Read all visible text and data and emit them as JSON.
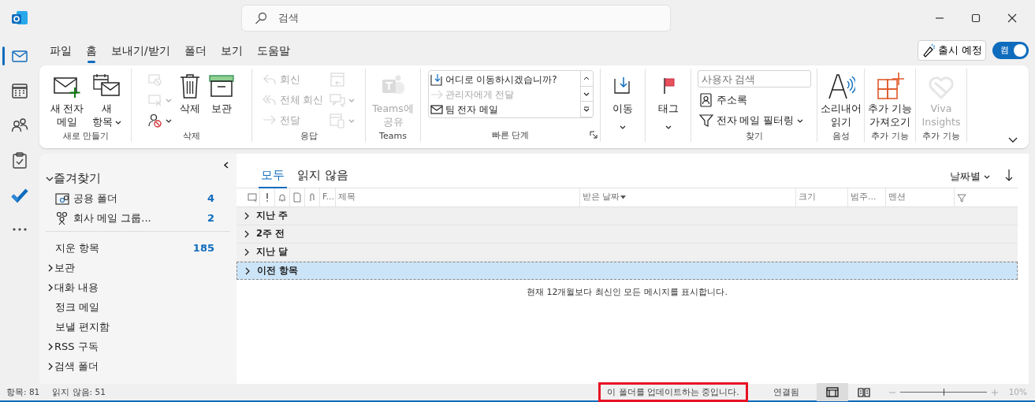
{
  "window": {
    "search_placeholder": "검색"
  },
  "rail": [
    {
      "selected": true
    },
    {
      "selected": false
    },
    {
      "selected": false
    },
    {
      "selected": false
    },
    {
      "selected": false
    },
    {
      "selected": false
    }
  ],
  "menu_tabs": [
    {
      "label": "파일",
      "selected": false
    },
    {
      "label": "홈",
      "selected": true
    },
    {
      "label": "보내기/받기",
      "selected": false
    },
    {
      "label": "폴더",
      "selected": false
    },
    {
      "label": "보기",
      "selected": false
    },
    {
      "label": "도움말",
      "selected": false
    }
  ],
  "coming_soon": {
    "label": "출시 예정",
    "toggle_label": "켬",
    "on": true
  },
  "ribbon": {
    "groups": [
      {
        "label": "새로 만들기",
        "items": [
          {
            "kind": "large",
            "lines": [
              "새 전자",
              "메일"
            ],
            "disabled": false,
            "dropdown": false
          },
          {
            "kind": "large",
            "lines": [
              "새",
              "항목"
            ],
            "disabled": false,
            "dropdown": true
          }
        ]
      },
      {
        "label": "삭제",
        "items": [
          {
            "kind": "stack",
            "entries": [
              {
                "disabled": true,
                "dropdown": false
              },
              {
                "disabled": true,
                "dropdown": true
              },
              {
                "disabled": false,
                "dropdown": true
              }
            ]
          },
          {
            "kind": "large",
            "lines": [
              "삭제"
            ],
            "disabled": false,
            "dropdown": false
          },
          {
            "kind": "large",
            "lines": [
              "보관"
            ],
            "disabled": false,
            "dropdown": false
          }
        ]
      },
      {
        "label": "응답",
        "items": [
          {
            "kind": "stack",
            "entries": [
              {
                "label": "회신",
                "disabled": true,
                "dropdown": false
              },
              {
                "label": "전체 회신",
                "disabled": true,
                "dropdown": false
              },
              {
                "label": "전달",
                "disabled": true,
                "dropdown": false
              }
            ]
          },
          {
            "kind": "stack",
            "entries": [
              {
                "disabled": true,
                "dropdown": false
              },
              {
                "disabled": true,
                "dropdown": true
              },
              {
                "disabled": true,
                "dropdown": true
              }
            ]
          }
        ]
      },
      {
        "label": "Teams",
        "items": [
          {
            "kind": "large",
            "lines": [
              "Teams에",
              "공유"
            ],
            "disabled": true,
            "dropdown": false
          }
        ]
      },
      {
        "label": "빠른 단계",
        "launcher": true,
        "items": [
          {
            "kind": "gallery",
            "entries": [
              {
                "label": "어디로 이동하시겠습니까?",
                "disabled": false
              },
              {
                "label": "관리자에게 전달",
                "disabled": true
              },
              {
                "label": "팀 전자 메일",
                "disabled": false
              }
            ]
          }
        ]
      },
      {
        "items": [
          {
            "kind": "large",
            "lines": [
              "이동"
            ],
            "disabled": false,
            "dropdown": true
          }
        ]
      },
      {
        "items": [
          {
            "kind": "large",
            "lines": [
              "태그"
            ],
            "disabled": false,
            "dropdown": true
          }
        ]
      },
      {
        "label": "찾기",
        "items": [
          {
            "kind": "stack",
            "entries": [
              {
                "placeholder": "사용자 검색"
              },
              {
                "label": "주소록",
                "disabled": false,
                "dropdown": false
              },
              {
                "label": "전자 메일 필터링",
                "disabled": false,
                "dropdown": true
              }
            ]
          }
        ]
      },
      {
        "label": "음성",
        "items": [
          {
            "kind": "large",
            "lines": [
              "소리내어",
              "읽기"
            ],
            "disabled": false,
            "dropdown": false
          }
        ]
      },
      {
        "label": "추가 기능",
        "items": [
          {
            "kind": "large",
            "lines": [
              "추가 기능",
              "가져오기"
            ],
            "disabled": false,
            "dropdown": false
          }
        ]
      },
      {
        "label": "추가 기능",
        "items": [
          {
            "kind": "large",
            "lines": [
              "Viva",
              "Insights"
            ],
            "disabled": true,
            "dropdown": false
          }
        ]
      }
    ]
  },
  "folders": {
    "favorites": {
      "label": "즐겨찾기",
      "expanded": true,
      "items": [
        {
          "label": "공용 폴더",
          "count": "4"
        },
        {
          "label": "회사 메일 그룹...",
          "count": "2"
        }
      ]
    },
    "items": [
      {
        "label": "지운 항목",
        "count": "185"
      },
      {
        "label": "보관",
        "expanded": false
      },
      {
        "label": "대화 내용",
        "expanded": false
      },
      {
        "label": "정크 메일"
      },
      {
        "label": "보낼 편지함"
      },
      {
        "label": "RSS 구독",
        "expanded": false
      },
      {
        "label": "검색 폴더",
        "expanded": false
      }
    ]
  },
  "mail_list": {
    "tabs": [
      {
        "label": "모두",
        "selected": true
      },
      {
        "label": "읽지 않음",
        "selected": false
      }
    ],
    "sort": "날짜별",
    "columns": [
      "F...",
      "제목",
      "받은 날짜",
      "크기",
      "범주...",
      "멘션"
    ],
    "groups": [
      {
        "label": "지난 주",
        "selected": false
      },
      {
        "label": "2주 전",
        "selected": false
      },
      {
        "label": "지난 달",
        "selected": false
      },
      {
        "label": "이전 항목",
        "selected": true
      }
    ],
    "notice": "현재 12개월보다 최신인 모든 메시지를 표시합니다."
  },
  "status_bar": {
    "items": "항목: 81",
    "unread": "읽지 않음: 51",
    "message": "이 폴더를 업데이트하는 중입니다.",
    "message_highlighted": true,
    "connection": "연결됨",
    "views": [
      {
        "selected": true
      },
      {
        "selected": false
      }
    ],
    "zoom": {
      "level": 0.5,
      "reading": "10%"
    }
  }
}
